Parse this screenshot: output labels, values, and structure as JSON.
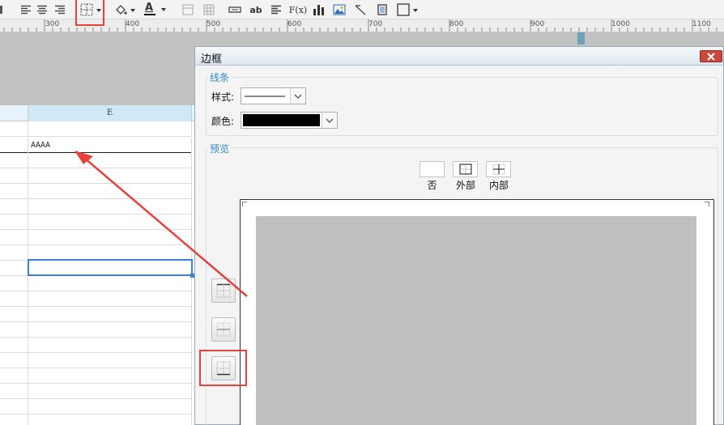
{
  "toolbar": {
    "icons": [
      "align-left-icon",
      "align-center-icon",
      "align-right-icon",
      "border-icon",
      "fill-color-icon",
      "font-color-icon",
      "merge-icon",
      "grid-icon",
      "input-icon",
      "text-ab",
      "align-icon",
      "formula-icon",
      "chart-icon",
      "image-icon",
      "slash-icon",
      "frame-icon",
      "border-dropdown-icon"
    ],
    "text_label": "ab",
    "formula_label": "F(x)",
    "font_color_label": "A",
    "accent_red": "#e8403a"
  },
  "ruler": {
    "labels": [
      "300",
      "400",
      "500",
      "600",
      "700",
      "800",
      "900",
      "1000",
      "1100"
    ]
  },
  "sheet": {
    "column_header": "E",
    "cell_value": "AAAA",
    "selection_color": "#3b82d6"
  },
  "dialog": {
    "title": "边框",
    "line_group": {
      "title": "线条",
      "style_label": "样式:",
      "color_label": "颜色:",
      "color_value": "#000000"
    },
    "preview_group": {
      "title": "预览",
      "presets": [
        {
          "label": "否"
        },
        {
          "label": "外部"
        },
        {
          "label": "内部"
        }
      ]
    }
  }
}
